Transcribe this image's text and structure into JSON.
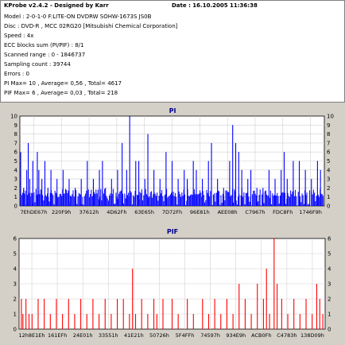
{
  "header": {
    "title": "KProbe v2.4.2 - Designed by Karr",
    "date": "Date : 16.10.2005 11:36:38",
    "lines": [
      "Model : 2-0-1-0 F:LITE-ON DVDRW SOHW-1673S JS0B",
      "Disc : DVD-R , MCC 02RG20  [Mitsubishi Chemical Corporation]",
      "Speed : 4x",
      "ECC blocks sum (PI/PIF) : 8/1",
      "Scanned range : 0 - 1846737",
      "Sampling count : 39744",
      "Errors : 0",
      "PI Max= 10 , Average= 0,56 , Total= 4617",
      "PIF Max= 6 , Average= 0,03 , Total= 218"
    ]
  },
  "chart_data": [
    {
      "type": "bar",
      "title": "PI",
      "color": "#0000ff",
      "ylim": [
        0,
        10
      ],
      "yticks": [
        0,
        1,
        2,
        3,
        4,
        5,
        6,
        7,
        8,
        9,
        10
      ],
      "xticks": [
        "7EhDE67h",
        "220F9h",
        "37612h",
        "4D62Fh",
        "63E65h",
        "7D72Fh",
        "96E81h",
        "AEE08h",
        "C7967h",
        "FDC8Fh",
        "1746F9h"
      ],
      "grid": true,
      "spikes": [
        {
          "x": 0.0,
          "v": 6
        },
        {
          "x": 0.01,
          "v": 2
        },
        {
          "x": 0.02,
          "v": 4
        },
        {
          "x": 0.025,
          "v": 7
        },
        {
          "x": 0.03,
          "v": 3
        },
        {
          "x": 0.04,
          "v": 5
        },
        {
          "x": 0.055,
          "v": 6
        },
        {
          "x": 0.06,
          "v": 4
        },
        {
          "x": 0.07,
          "v": 3
        },
        {
          "x": 0.08,
          "v": 5
        },
        {
          "x": 0.09,
          "v": 2
        },
        {
          "x": 0.1,
          "v": 4
        },
        {
          "x": 0.12,
          "v": 3
        },
        {
          "x": 0.14,
          "v": 4
        },
        {
          "x": 0.16,
          "v": 3
        },
        {
          "x": 0.18,
          "v": 2
        },
        {
          "x": 0.2,
          "v": 3
        },
        {
          "x": 0.22,
          "v": 5
        },
        {
          "x": 0.24,
          "v": 3
        },
        {
          "x": 0.26,
          "v": 4
        },
        {
          "x": 0.27,
          "v": 5
        },
        {
          "x": 0.28,
          "v": 2
        },
        {
          "x": 0.3,
          "v": 3
        },
        {
          "x": 0.32,
          "v": 4
        },
        {
          "x": 0.335,
          "v": 7
        },
        {
          "x": 0.35,
          "v": 4
        },
        {
          "x": 0.36,
          "v": 10
        },
        {
          "x": 0.38,
          "v": 5
        },
        {
          "x": 0.39,
          "v": 5
        },
        {
          "x": 0.41,
          "v": 3
        },
        {
          "x": 0.42,
          "v": 8
        },
        {
          "x": 0.44,
          "v": 4
        },
        {
          "x": 0.46,
          "v": 3
        },
        {
          "x": 0.48,
          "v": 6
        },
        {
          "x": 0.5,
          "v": 5
        },
        {
          "x": 0.52,
          "v": 3
        },
        {
          "x": 0.54,
          "v": 4
        },
        {
          "x": 0.55,
          "v": 3
        },
        {
          "x": 0.57,
          "v": 5
        },
        {
          "x": 0.58,
          "v": 4
        },
        {
          "x": 0.6,
          "v": 3
        },
        {
          "x": 0.62,
          "v": 5
        },
        {
          "x": 0.63,
          "v": 7
        },
        {
          "x": 0.65,
          "v": 3
        },
        {
          "x": 0.67,
          "v": 2
        },
        {
          "x": 0.69,
          "v": 5
        },
        {
          "x": 0.7,
          "v": 9
        },
        {
          "x": 0.71,
          "v": 7
        },
        {
          "x": 0.72,
          "v": 6
        },
        {
          "x": 0.73,
          "v": 4
        },
        {
          "x": 0.75,
          "v": 3
        },
        {
          "x": 0.76,
          "v": 4
        },
        {
          "x": 0.78,
          "v": 2
        },
        {
          "x": 0.8,
          "v": 2
        },
        {
          "x": 0.82,
          "v": 4
        },
        {
          "x": 0.84,
          "v": 3
        },
        {
          "x": 0.86,
          "v": 4
        },
        {
          "x": 0.87,
          "v": 6
        },
        {
          "x": 0.88,
          "v": 3
        },
        {
          "x": 0.9,
          "v": 5
        },
        {
          "x": 0.92,
          "v": 5
        },
        {
          "x": 0.94,
          "v": 4
        },
        {
          "x": 0.96,
          "v": 3
        },
        {
          "x": 0.98,
          "v": 5
        },
        {
          "x": 0.99,
          "v": 4
        }
      ]
    },
    {
      "type": "bar",
      "title": "PIF",
      "color": "#ff0000",
      "ylim": [
        0,
        6
      ],
      "yticks": [
        0,
        1,
        2,
        3,
        4,
        5,
        6
      ],
      "xticks": [
        "12h8E1Eh",
        "161EFh",
        "24E01h",
        "33551h",
        "41E21h",
        "50726h",
        "5F4FFh",
        "74597h",
        "934E9h",
        "ACB0Fh",
        "C4783h",
        "138D09h"
      ],
      "grid": true,
      "spikes": [
        {
          "x": 0.005,
          "v": 2
        },
        {
          "x": 0.01,
          "v": 1
        },
        {
          "x": 0.02,
          "v": 2
        },
        {
          "x": 0.03,
          "v": 1
        },
        {
          "x": 0.04,
          "v": 1
        },
        {
          "x": 0.06,
          "v": 2
        },
        {
          "x": 0.08,
          "v": 2
        },
        {
          "x": 0.1,
          "v": 1
        },
        {
          "x": 0.12,
          "v": 2
        },
        {
          "x": 0.14,
          "v": 1
        },
        {
          "x": 0.16,
          "v": 2
        },
        {
          "x": 0.18,
          "v": 1
        },
        {
          "x": 0.2,
          "v": 2
        },
        {
          "x": 0.22,
          "v": 1
        },
        {
          "x": 0.24,
          "v": 2
        },
        {
          "x": 0.26,
          "v": 1
        },
        {
          "x": 0.28,
          "v": 2
        },
        {
          "x": 0.3,
          "v": 1
        },
        {
          "x": 0.32,
          "v": 2
        },
        {
          "x": 0.34,
          "v": 2
        },
        {
          "x": 0.36,
          "v": 1
        },
        {
          "x": 0.37,
          "v": 4
        },
        {
          "x": 0.38,
          "v": 1
        },
        {
          "x": 0.4,
          "v": 2
        },
        {
          "x": 0.42,
          "v": 1
        },
        {
          "x": 0.44,
          "v": 2
        },
        {
          "x": 0.45,
          "v": 1
        },
        {
          "x": 0.47,
          "v": 2
        },
        {
          "x": 0.5,
          "v": 2
        },
        {
          "x": 0.52,
          "v": 1
        },
        {
          "x": 0.55,
          "v": 2
        },
        {
          "x": 0.57,
          "v": 1
        },
        {
          "x": 0.6,
          "v": 2
        },
        {
          "x": 0.62,
          "v": 1
        },
        {
          "x": 0.64,
          "v": 2
        },
        {
          "x": 0.66,
          "v": 1
        },
        {
          "x": 0.68,
          "v": 2
        },
        {
          "x": 0.7,
          "v": 1
        },
        {
          "x": 0.72,
          "v": 3
        },
        {
          "x": 0.74,
          "v": 2
        },
        {
          "x": 0.76,
          "v": 1
        },
        {
          "x": 0.78,
          "v": 3
        },
        {
          "x": 0.8,
          "v": 2
        },
        {
          "x": 0.81,
          "v": 4
        },
        {
          "x": 0.82,
          "v": 1
        },
        {
          "x": 0.835,
          "v": 6
        },
        {
          "x": 0.845,
          "v": 3
        },
        {
          "x": 0.86,
          "v": 2
        },
        {
          "x": 0.88,
          "v": 1
        },
        {
          "x": 0.9,
          "v": 2
        },
        {
          "x": 0.92,
          "v": 1
        },
        {
          "x": 0.94,
          "v": 2
        },
        {
          "x": 0.96,
          "v": 1
        },
        {
          "x": 0.975,
          "v": 3
        },
        {
          "x": 0.985,
          "v": 2
        },
        {
          "x": 0.995,
          "v": 1
        }
      ]
    }
  ]
}
